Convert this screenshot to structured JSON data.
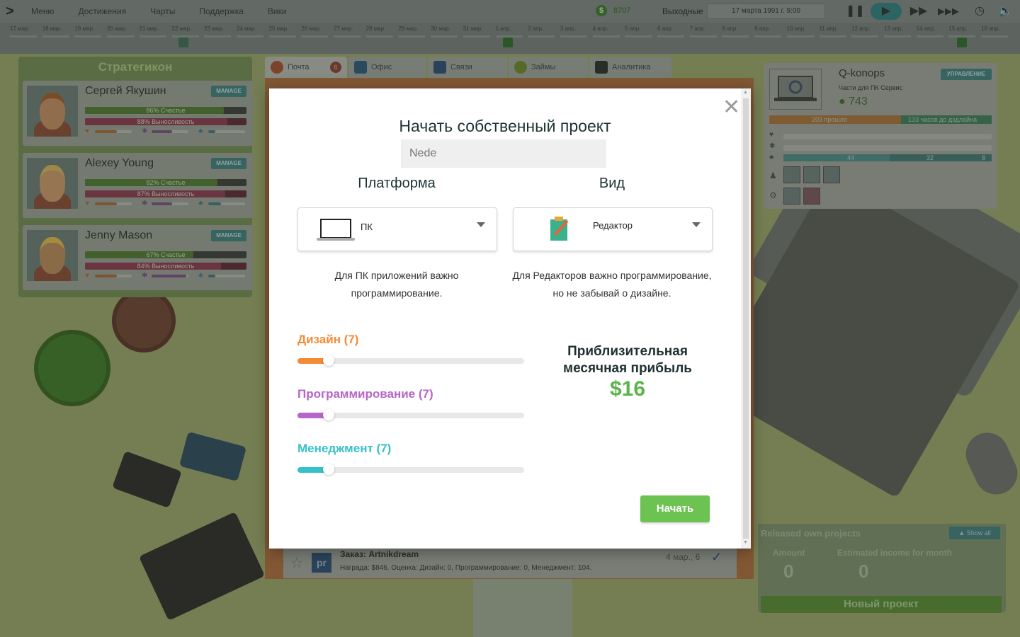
{
  "topbar": {
    "nav": [
      "Меню",
      "Достижения",
      "Чарты",
      "Поддержка",
      "Вики"
    ],
    "money": "8707",
    "weekend_label": "Выходные",
    "date": "17 марта 1991 г. 9:00"
  },
  "timeline": {
    "days": [
      "17 мар.",
      "18 мар.",
      "19 мар.",
      "20 мар.",
      "21 мар.",
      "22 мар.",
      "23 мар.",
      "24 мар.",
      "25 мар.",
      "26 мар.",
      "27 мар.",
      "28 мар.",
      "29 мар.",
      "30 мар.",
      "31 мар.",
      "1 апр.",
      "2 апр.",
      "3 апр.",
      "4 апр.",
      "5 апр.",
      "6 апр.",
      "7 апр.",
      "8 апр.",
      "9 апр.",
      "10 апр.",
      "11 апр.",
      "12 апр.",
      "13 апр.",
      "14 апр.",
      "15 апр.",
      "16 апр."
    ]
  },
  "team": {
    "title": "Стратегикон",
    "manage_label": "MANAGE",
    "employees": [
      {
        "name": "Сергей Якушин",
        "happiness": "86% Счастье",
        "happiness_pct": 86,
        "stamina": "88% Выносливость",
        "stamina_pct": 88
      },
      {
        "name": "Alexey Young",
        "happiness": "82% Счастье",
        "happiness_pct": 82,
        "stamina": "87% Выносливость",
        "stamina_pct": 87
      },
      {
        "name": "Jenny Mason",
        "happiness": "67% Счастье",
        "happiness_pct": 67,
        "stamina": "84% Выносливость",
        "stamina_pct": 84
      }
    ]
  },
  "tabs": [
    {
      "label": "Почта",
      "badge": "6"
    },
    {
      "label": "Офис"
    },
    {
      "label": "Связи"
    },
    {
      "label": "Займы"
    },
    {
      "label": "Аналитика"
    }
  ],
  "mail": {
    "subject": "Заказ: Artnikdream",
    "meta": "Награда: $846. Оценка: Дизайн: 0, Программирование: 0, Менеджмент: 104.",
    "date": "4 мар., 6",
    "pr_icon": "pr"
  },
  "project": {
    "name": "Q-konops",
    "manage_label": "УПРАВЛЕНИЕ",
    "subtitle": "Части для ПК Сервис",
    "value": "743",
    "time_passed": "203 прошло",
    "time_left": "133 часов до дэдлайна",
    "progress_a": "44",
    "progress_b": "32",
    "progress_c": "8"
  },
  "released": {
    "title": "Released own projects",
    "show_all": "Show all",
    "amount_label": "Amount",
    "income_label": "Estimated income for month",
    "amount": "0",
    "income": "0",
    "new_project": "Новый проект"
  },
  "modal": {
    "title": "Начать собственный проект",
    "name_placeholder": "Nede",
    "platform_label": "Платформа",
    "type_label": "Вид",
    "platform_value": "ПК",
    "type_value": "Редактор",
    "platform_hint": "Для ПК приложений важно программирование.",
    "type_hint": "Для Редакторов важно программирование, но не забывай о дизайне.",
    "skills": [
      {
        "label": "Дизайн (7)",
        "color": "#f58a35",
        "level_pct": 13
      },
      {
        "label": "Программирование (7)",
        "color": "#b665c9",
        "level_pct": 13
      },
      {
        "label": "Менеджмент (7)",
        "color": "#35c2c7",
        "level_pct": 13
      }
    ],
    "profit_label": "Приблизительная месячная прибыль",
    "profit_value": "$16",
    "start_label": "Начать",
    "close_icon": "close-icon"
  },
  "colors": {
    "accent_green": "#6cc352",
    "profit_green": "#5ab447"
  }
}
